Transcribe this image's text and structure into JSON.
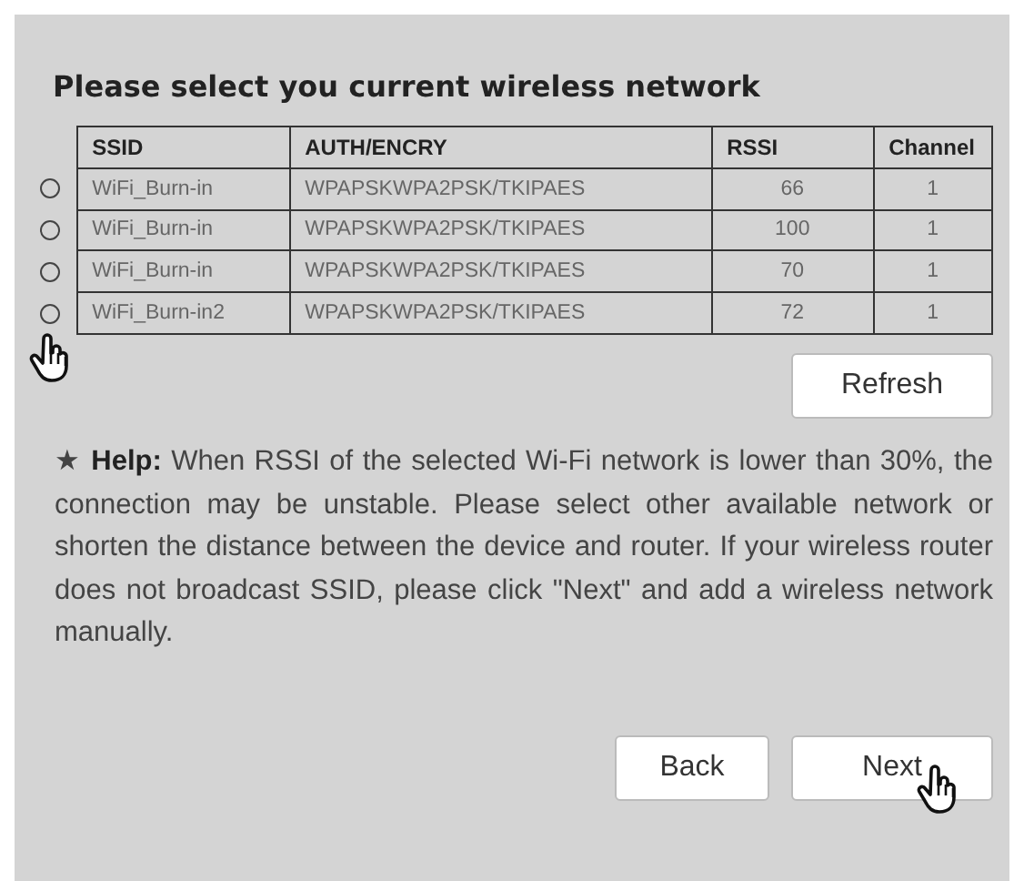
{
  "title": "Please select you current wireless network",
  "table": {
    "columns": [
      "SSID",
      "AUTH/ENCRY",
      "RSSI",
      "Channel"
    ],
    "rows": [
      {
        "selected": false,
        "cells": [
          "WiFi_Burn-in",
          "WPAPSKWPA2PSK/TKIPAES",
          "66",
          "1"
        ]
      },
      {
        "selected": false,
        "cells": [
          "WiFi_Burn-in",
          "WPAPSKWPA2PSK/TKIPAES",
          "100",
          "1"
        ]
      },
      {
        "selected": false,
        "cells": [
          "WiFi_Burn-in",
          "WPAPSKWPA2PSK/TKIPAES",
          "70",
          "1"
        ]
      },
      {
        "selected": false,
        "cells": [
          "WiFi_Burn-in2",
          "WPAPSKWPA2PSK/TKIPAES",
          "72",
          "1"
        ]
      }
    ]
  },
  "refresh_button": "Refresh",
  "help": "★ **Help:** When RSSI of the selected Wi-Fi network is lower than 30%, the connection may be unstable. Please select other available network or shorten the distance between the device and router. If your wireless router does not broadcast SSID, please click \"Next\" and add a wireless network manually.",
  "buttons": [
    "Back",
    "Next"
  ]
}
